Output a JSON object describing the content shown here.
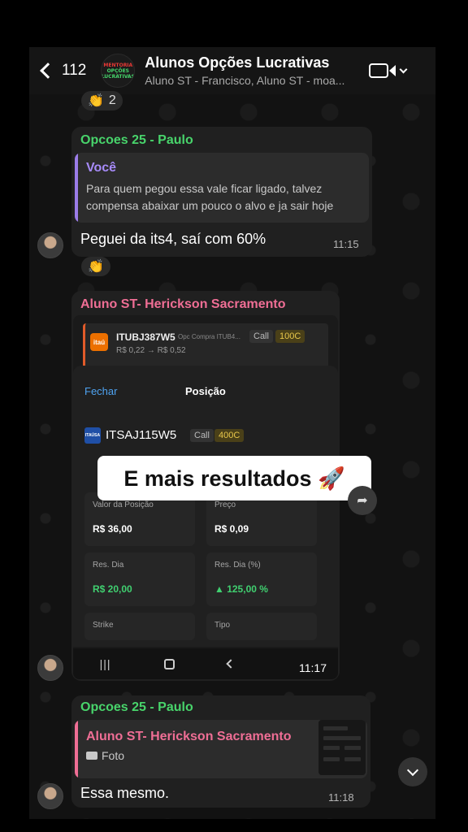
{
  "header": {
    "back_count": "112",
    "group_title": "Alunos Opções Lucrativas",
    "subtitle": "Aluno ST - Francisco, Aluno ST - moa...",
    "avatar_text": [
      "MENTORIA",
      "OPÇÕES",
      "LUCRATIVAS"
    ]
  },
  "reactions": {
    "first": {
      "emoji": "👏",
      "count": "2"
    },
    "second": {
      "emoji": "👏"
    }
  },
  "messages": [
    {
      "sender": "Opcoes 25 - Paulo",
      "quote_author": "Você",
      "quote_text": "Para quem pegou essa vale ficar ligado, talvez compensa abaixar um pouco o alvo e ja sair hoje",
      "text": "Peguei da its4, saí com 60%",
      "time": "11:15"
    },
    {
      "sender": "Aluno ST- Herickson Sacramento",
      "time": "11:17",
      "screenshot": {
        "top_ticker": "ITUBJ387W5",
        "top_ticker_sub": "Opc Compra ITUB4...",
        "top_type": "Call",
        "top_strike": "100C",
        "top_price_from": "R$ 0,22",
        "top_price_to": "R$ 0,52",
        "top_logo": "itaú",
        "close_label": "Fechar",
        "sheet_title": "Posição",
        "position_ticker": "ITSAJ115W5",
        "position_logo": "ITAÚSA",
        "position_type": "Call",
        "position_strike": "400C",
        "cells": [
          {
            "label": "Valor da Posição",
            "value": "R$ 36,00"
          },
          {
            "label": "Preço",
            "value": "R$ 0,09"
          },
          {
            "label": "Res. Dia",
            "value": "R$ 20,00"
          },
          {
            "label": "Res. Dia (%)",
            "value": "▲ 125,00 %"
          },
          {
            "label": "Strike",
            "value": ""
          },
          {
            "label": "Tipo",
            "value": ""
          }
        ],
        "nav_recent": "|||"
      },
      "overlay_caption": "E mais resultados 🚀"
    },
    {
      "sender": "Opcoes 25 - Paulo",
      "quote_author": "Aluno ST- Herickson Sacramento",
      "quote_media": "Foto",
      "text": "Essa mesmo.",
      "time": "11:18"
    }
  ]
}
